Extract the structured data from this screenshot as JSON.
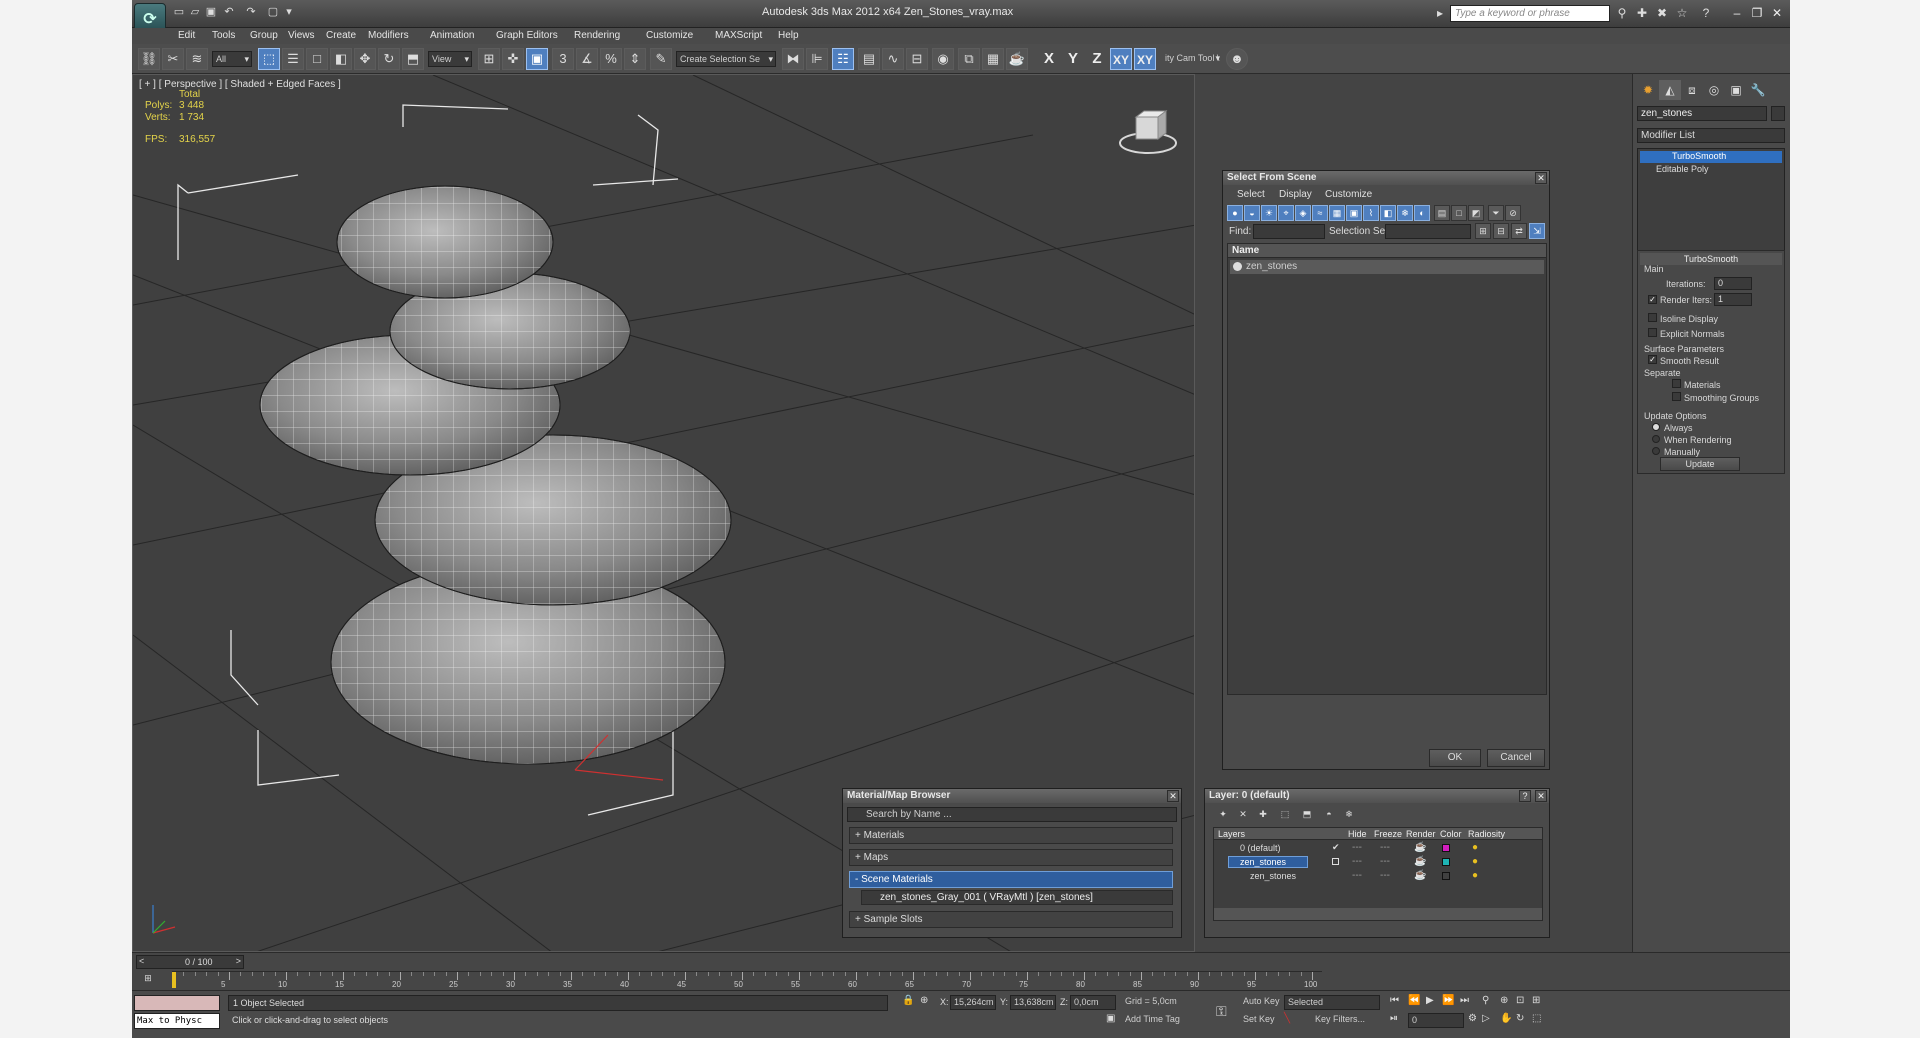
{
  "window": {
    "title": "Autodesk 3ds Max  2012 x64     Zen_Stones_vray.max",
    "search_placeholder": "Type a keyword or phrase"
  },
  "menu": [
    "Edit",
    "Tools",
    "Group",
    "Views",
    "Create",
    "Modifiers",
    "Animation",
    "Graph Editors",
    "Rendering",
    "Customize",
    "MAXScript",
    "Help"
  ],
  "toolbar": {
    "selection_filter": "All",
    "ref_coord": "View",
    "named_selection": "Create Selection Se",
    "axis_x": "X",
    "axis_y": "Y",
    "axis_z": "Z",
    "axis_xy": "XY",
    "axis_xy2": "XY",
    "cam_tool": "ity Cam Tool \\"
  },
  "viewport": {
    "label": "[ + ] [ Perspective ] [ Shaded + Edged Faces ]",
    "stats": {
      "total": "Total",
      "polys_label": "Polys:",
      "polys": "3 448",
      "verts_label": "Verts:",
      "verts": "1 734",
      "fps_label": "FPS:",
      "fps": "316,557"
    }
  },
  "select_dialog": {
    "title": "Select From Scene",
    "menus": [
      "Select",
      "Display",
      "Customize"
    ],
    "find_label": "Find:",
    "selset_label": "Selection Set:",
    "col_name": "Name",
    "items": [
      "zen_stones"
    ],
    "ok": "OK",
    "cancel": "Cancel"
  },
  "material_browser": {
    "title": "Material/Map Browser",
    "search_placeholder": "Search by Name ...",
    "groups": [
      "+ Materials",
      "+ Maps",
      "- Scene Materials",
      "+ Sample Slots"
    ],
    "scene_material": "zen_stones_Gray_001  ( VRayMtl ) [zen_stones]"
  },
  "layer_dialog": {
    "title": "Layer: 0 (default)",
    "columns": [
      "Layers",
      "Hide",
      "Freeze",
      "Render",
      "Color",
      "Radiosity"
    ],
    "rows": [
      {
        "name": "0 (default)",
        "color": "#d21ebe"
      },
      {
        "name": "zen_stones",
        "color": "#1eb4b4"
      },
      {
        "name": "zen_stones",
        "color": "#404040"
      }
    ]
  },
  "command_panel": {
    "object_name": "zen_stones",
    "modifier_list": "Modifier List",
    "stack": [
      "TurboSmooth",
      "Editable Poly"
    ],
    "rollout_title": "TurboSmooth",
    "main_label": "Main",
    "iterations_label": "Iterations:",
    "iterations": "0",
    "render_iters_label": "Render Iters:",
    "render_iters": "1",
    "isoline": "Isoline Display",
    "explicit_normals": "Explicit Normals",
    "surface_params": "Surface Parameters",
    "smooth_result": "Smooth Result",
    "separate": "Separate",
    "materials": "Materials",
    "smoothing_groups": "Smoothing Groups",
    "update_options": "Update Options",
    "always": "Always",
    "when_rendering": "When Rendering",
    "manually": "Manually",
    "update_btn": "Update"
  },
  "timeline": {
    "frame": "0 / 100",
    "ticks": [
      "5",
      "10",
      "15",
      "20",
      "25",
      "30",
      "35",
      "40",
      "45",
      "50",
      "55",
      "60",
      "65",
      "70",
      "75",
      "80",
      "85",
      "90",
      "95",
      "100"
    ]
  },
  "status": {
    "maxscript": "Max to Physc",
    "selected": "1 Object Selected",
    "prompt": "Click or click-and-drag to select objects",
    "x_label": "X:",
    "x": "15,264cm",
    "y_label": "Y:",
    "y": "13,638cm",
    "z_label": "Z:",
    "z": "0,0cm",
    "grid": "Grid = 5,0cm",
    "add_time_tag": "Add Time Tag",
    "auto_key": "Auto Key",
    "auto_key_mode": "Selected",
    "set_key": "Set Key",
    "key_filters": "Key Filters...",
    "frame": "0"
  }
}
